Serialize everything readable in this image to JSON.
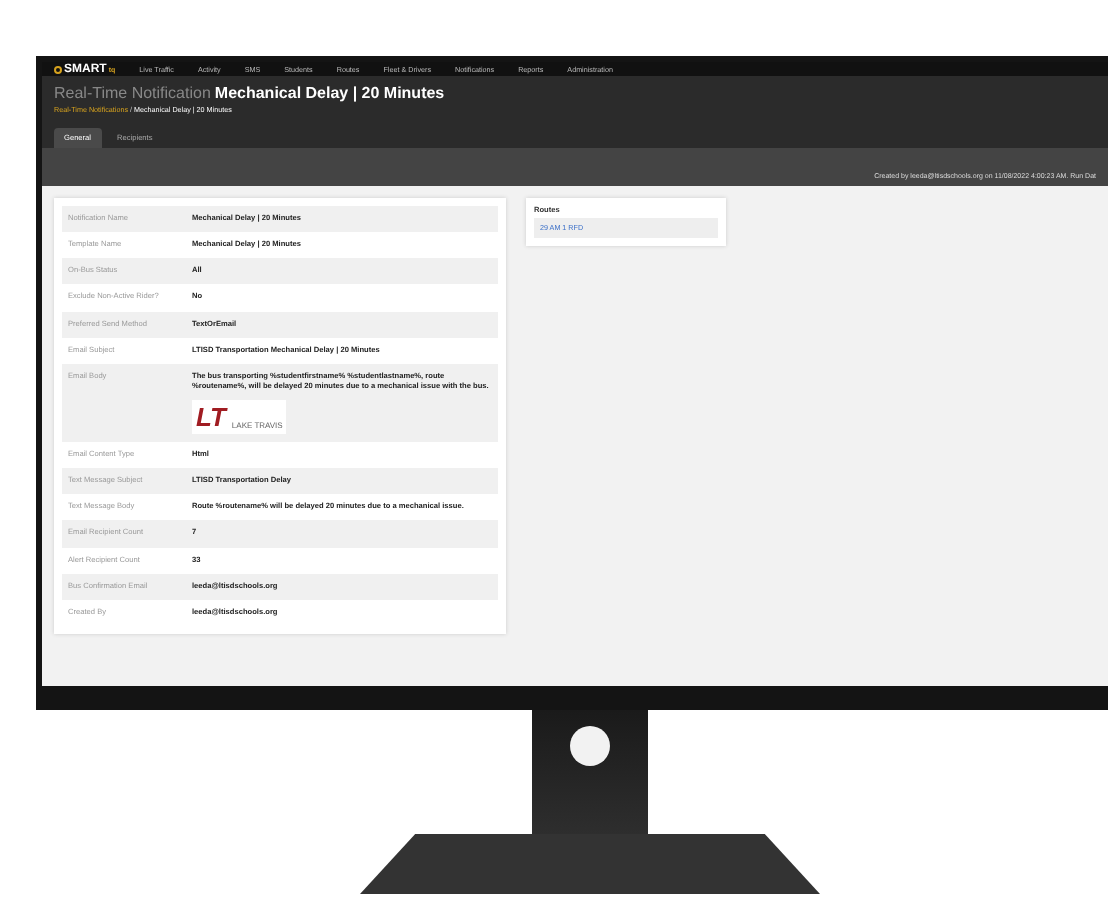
{
  "nav": {
    "logo": "SMART",
    "logo_sub": "tq",
    "items": [
      "Live Traffic",
      "Activity",
      "SMS",
      "Students",
      "Routes",
      "Fleet & Drivers",
      "Notifications",
      "Reports",
      "Administration"
    ]
  },
  "header": {
    "prefix": "Real-Time Notification",
    "name": "Mechanical Delay | 20 Minutes"
  },
  "breadcrumb": {
    "items": [
      "Real-Time Notifications",
      "Mechanical Delay | 20 Minutes"
    ],
    "separator": "/"
  },
  "tabs": [
    {
      "label": "General",
      "selected": true
    },
    {
      "label": "Recipients",
      "selected": false
    }
  ],
  "created_by": "Created by leeda@ltisdschools.org on 11/08/2022 4:00:23 AM. Run Dat",
  "details": [
    {
      "kind": "text",
      "label": "Notification Name",
      "value": "Mechanical Delay | 20 Minutes"
    },
    {
      "kind": "text",
      "label": "Template Name",
      "value": "Mechanical Delay | 20 Minutes"
    },
    {
      "kind": "text",
      "label": "On-Bus Status",
      "value": "All"
    },
    {
      "kind": "text",
      "label": "Exclude Non-Active Rider?",
      "value": "No"
    },
    {
      "kind": "text",
      "label": "Preferred Send Method",
      "value": "TextOrEmail"
    },
    {
      "kind": "text",
      "label": "Email Subject",
      "value": "LTISD Transportation Mechanical Delay | 20 Minutes"
    },
    {
      "kind": "email_body",
      "label": "Email Body",
      "value": "The bus transporting %studentfirstname% %studentlastname%, route %routename%, will be delayed 20 minutes due to a mechanical issue with the bus.",
      "logo": {
        "mark": "LT",
        "name": "LAKE TRAVIS"
      }
    },
    {
      "kind": "text",
      "label": "Email Content Type",
      "value": "Html"
    },
    {
      "kind": "text",
      "label": "Text Message Subject",
      "value": "LTISD Transportation Delay"
    },
    {
      "kind": "text",
      "label": "Text Message Body",
      "value": "Route %routename% will be delayed 20 minutes due to a mechanical issue."
    },
    {
      "kind": "text",
      "label": "Email Recipient Count",
      "value": "7"
    },
    {
      "kind": "text",
      "label": "Alert Recipient Count",
      "value": "33"
    },
    {
      "kind": "text",
      "label": "Bus Confirmation Email",
      "value": "leeda@ltisdschools.org"
    },
    {
      "kind": "text",
      "label": "Created By",
      "value": "leeda@ltisdschools.org"
    }
  ],
  "routes": {
    "title": "Routes",
    "items": [
      "29 AM 1 RFD"
    ]
  }
}
